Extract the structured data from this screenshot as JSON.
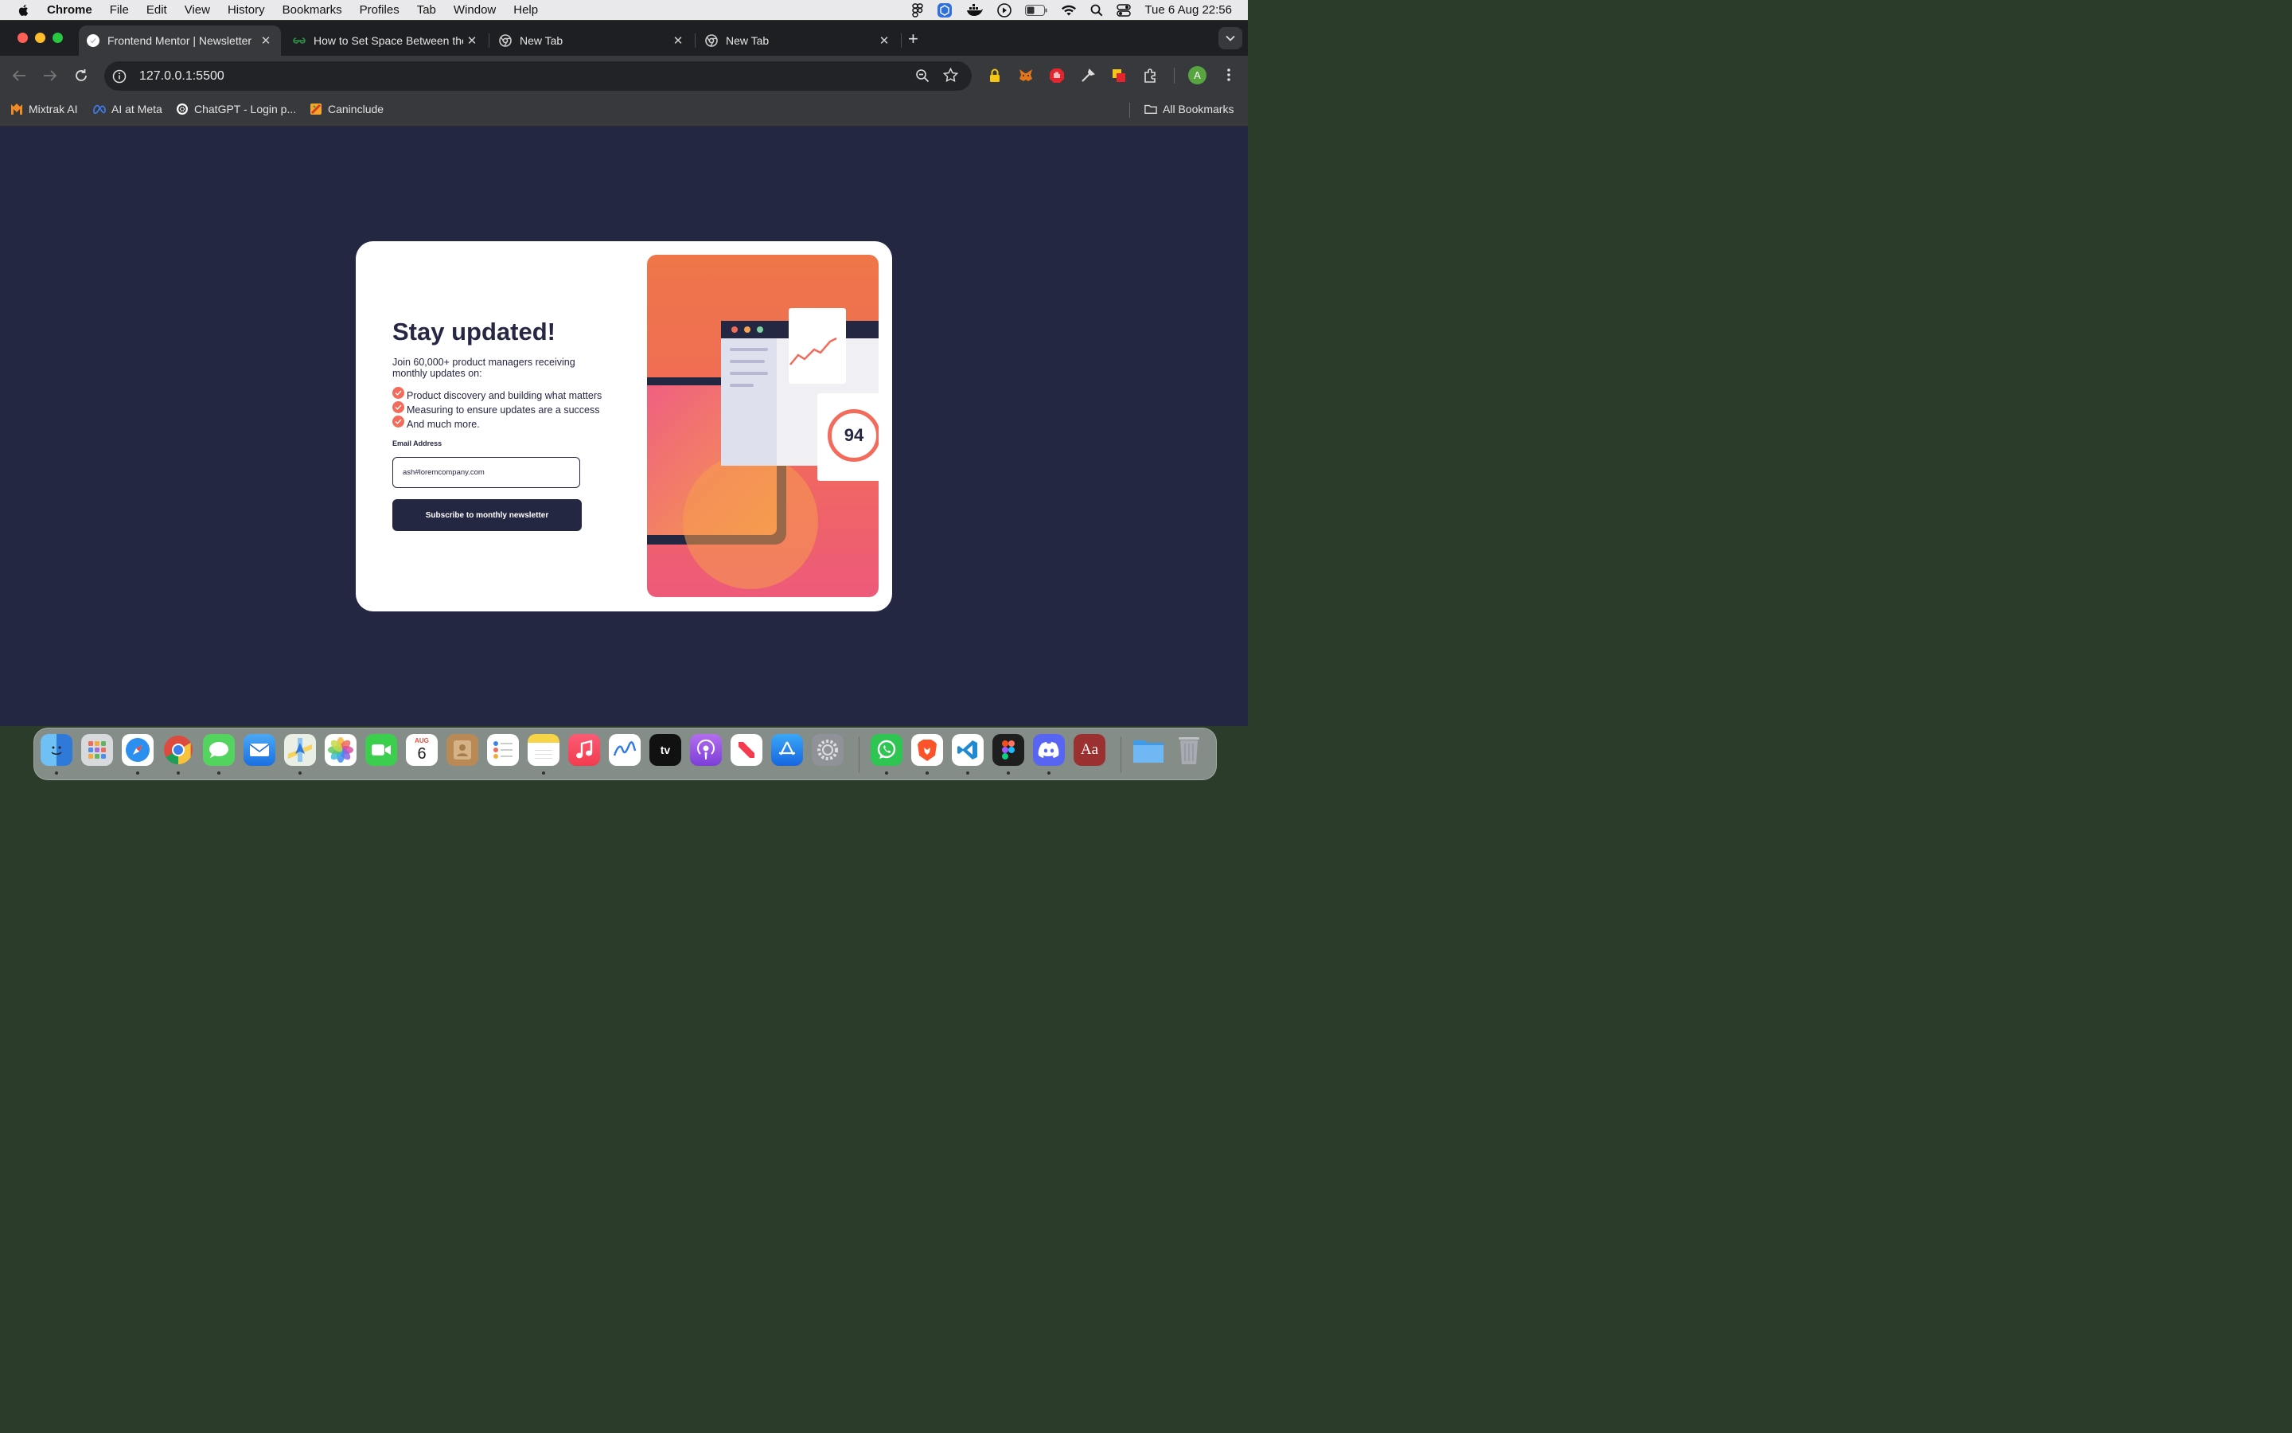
{
  "menubar": {
    "app": "Chrome",
    "menus": [
      "File",
      "Edit",
      "View",
      "History",
      "Bookmarks",
      "Profiles",
      "Tab",
      "Window",
      "Help"
    ],
    "clock": "Tue 6 Aug  22:56"
  },
  "tabs": [
    {
      "title": "Frontend Mentor | Newsletter",
      "active": true
    },
    {
      "title": "How to Set Space Between the",
      "active": false
    },
    {
      "title": "New Tab",
      "active": false
    },
    {
      "title": "New Tab",
      "active": false
    }
  ],
  "toolbar": {
    "url": "127.0.0.1:5500",
    "profile_initial": "A"
  },
  "bookmarks": [
    {
      "label": "Mixtrak AI",
      "icon": "mixtrak-icon"
    },
    {
      "label": "AI at Meta",
      "icon": "meta-icon"
    },
    {
      "label": "ChatGPT - Login p...",
      "icon": "openai-icon"
    },
    {
      "label": "Caninclude",
      "icon": "caninclude-icon"
    }
  ],
  "all_bookmarks": "All Bookmarks",
  "newsletter": {
    "heading": "Stay updated!",
    "intro": "Join 60,000+ product managers receiving monthly updates on:",
    "items": [
      "Product discovery and building what matters",
      "Measuring to ensure updates are a success",
      "And much more."
    ],
    "email_label": "Email Address",
    "email_value": "ash#loremcompany.com",
    "button": "Subscribe to monthly newsletter",
    "score": "94"
  },
  "calendar": {
    "month": "AUG",
    "day": "6"
  },
  "colors": {
    "accent": "#f26b5b",
    "dark_navy": "#242742",
    "chrome_dark": "#38393c"
  }
}
